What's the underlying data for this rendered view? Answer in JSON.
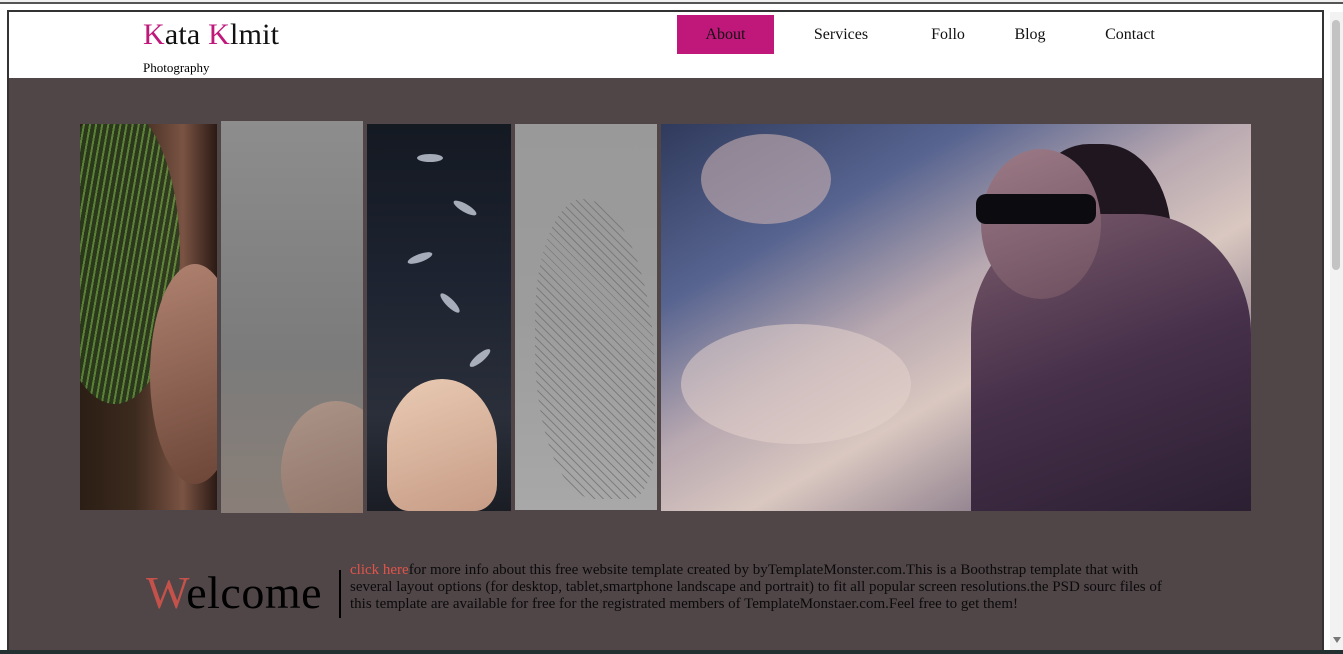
{
  "logo": {
    "first_initial": "K",
    "first_rest": "ata ",
    "second_initial": "K",
    "second_rest": "lmit",
    "tagline": "Photography"
  },
  "nav": {
    "items": [
      {
        "label": "About",
        "active": true
      },
      {
        "label": "Services",
        "active": false
      },
      {
        "label": "Follo",
        "active": false
      },
      {
        "label": "Blog",
        "active": false
      },
      {
        "label": "Contact",
        "active": false
      }
    ]
  },
  "welcome": {
    "title_initial": "W",
    "title_rest": "elcome",
    "link_text": "click here",
    "body_text": "for more info about this free website template created by byTemplateMonster.com.This is a Boothstrap template that with several layout options (for desktop, tablet,smartphone landscape and portrait) to fit all popular screen resolutions.the PSD sourc files of this template are available for free for the registrated members of TemplateMonstaer.com.Feel free to get them!"
  },
  "colors": {
    "accent": "#c0177b",
    "content_background": "#504648",
    "welcome_accent": "#c4524a",
    "link": "#e0544b"
  }
}
